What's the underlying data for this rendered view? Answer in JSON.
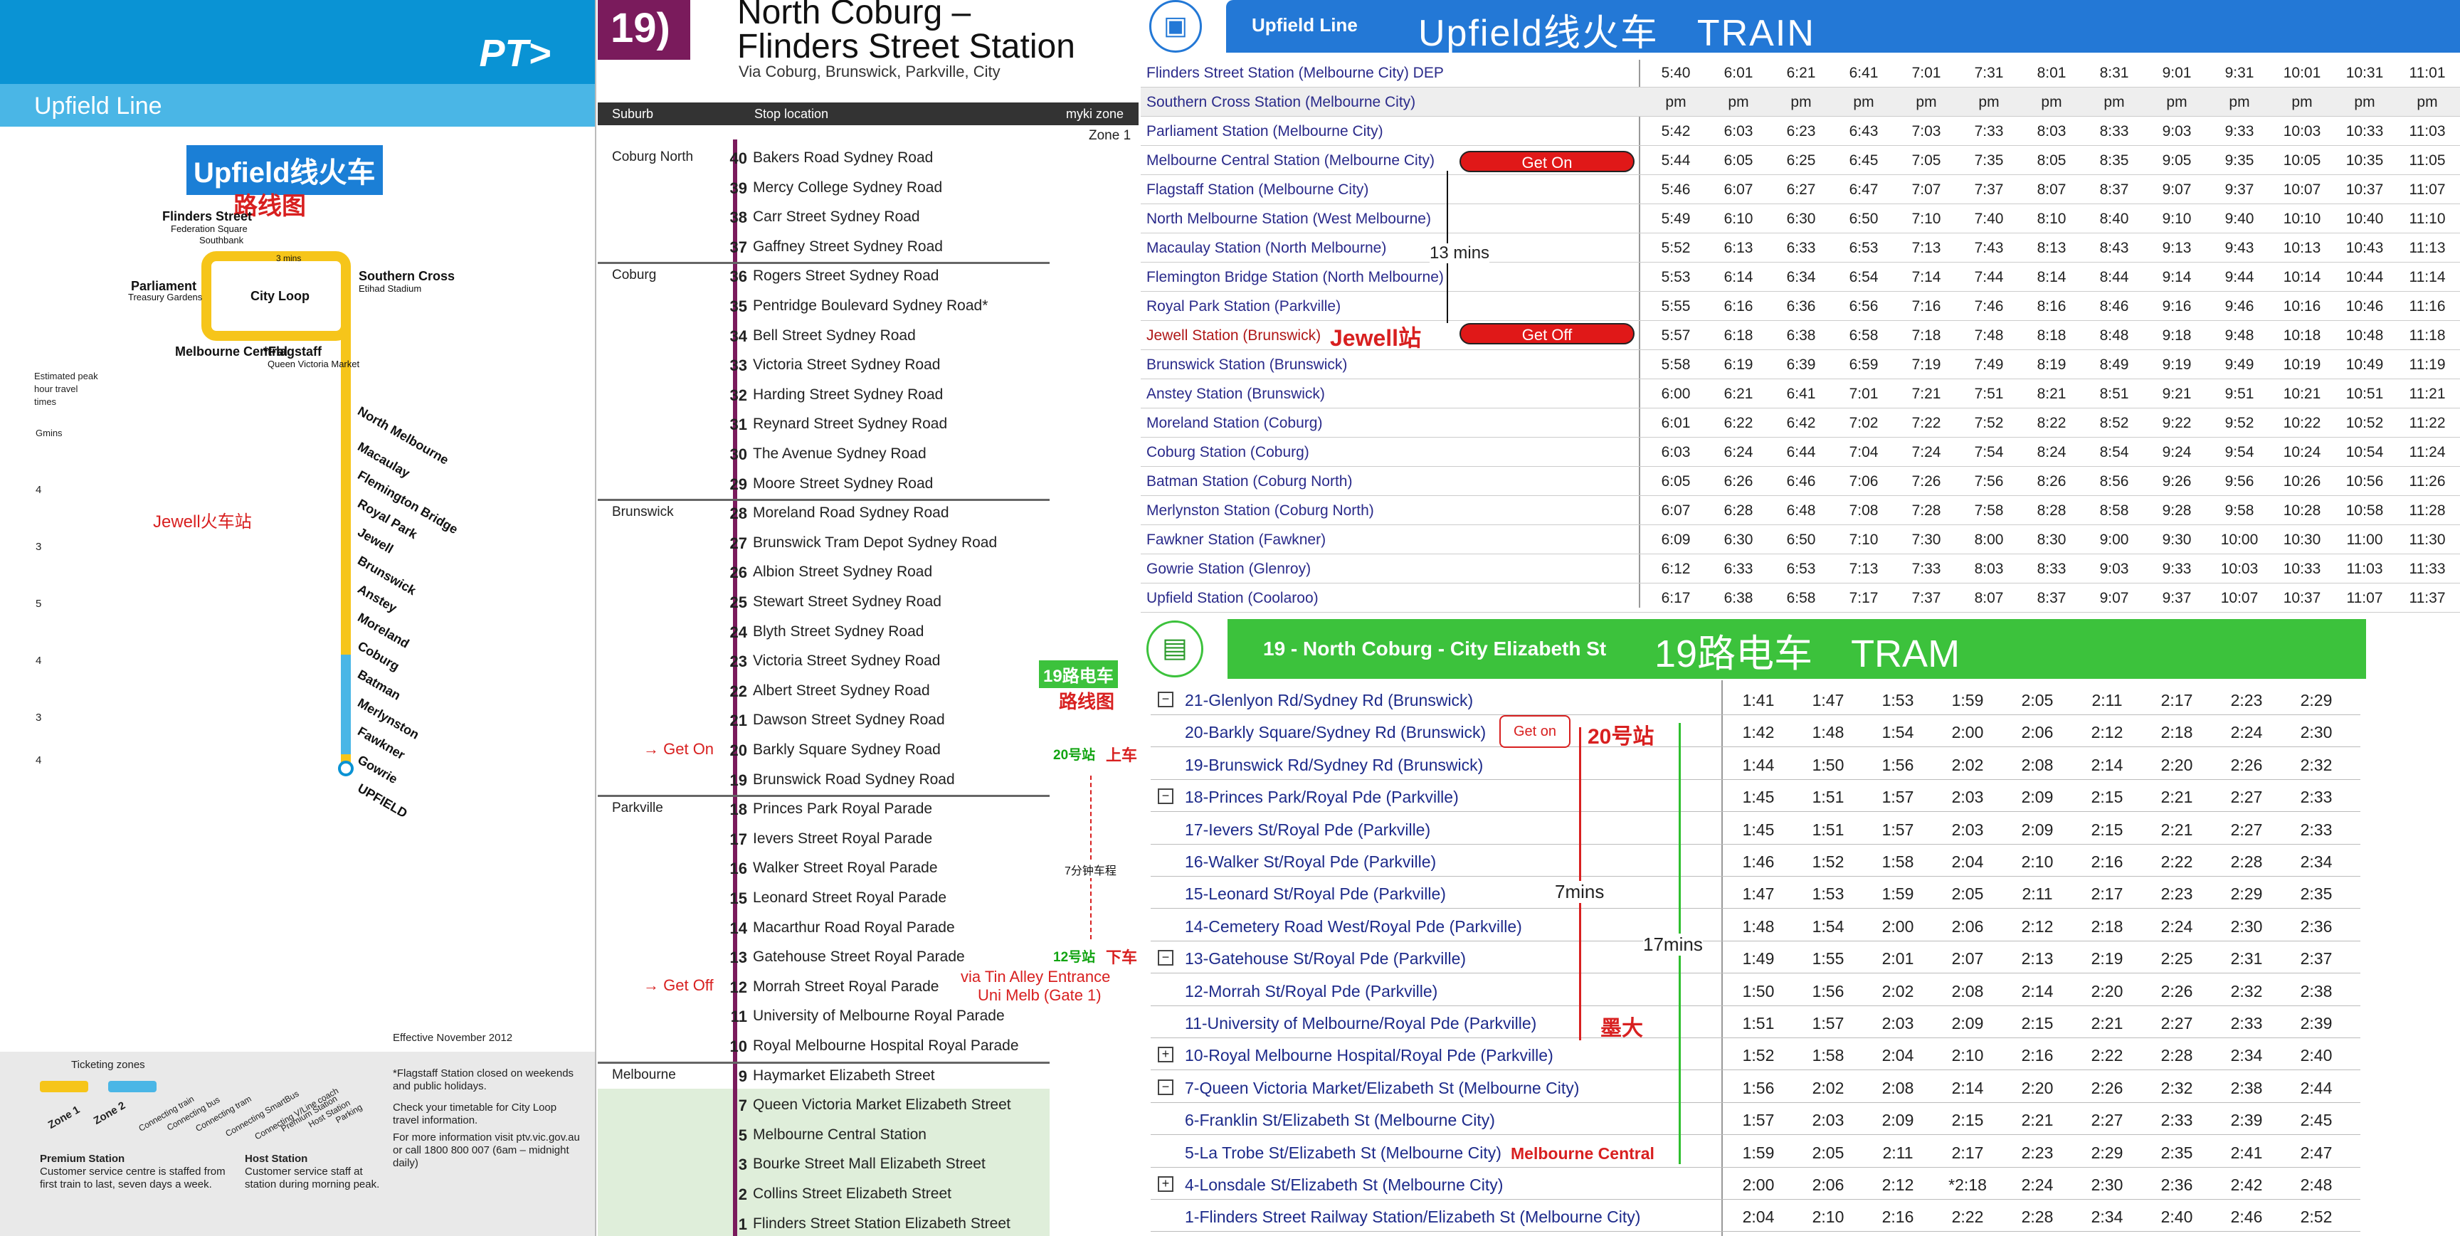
{
  "map": {
    "logo": "PT>",
    "line_name": "Upfield Line",
    "title_cn": "Upfield线火车",
    "subtitle_cn": "路线图",
    "stations": [
      "Flinders Street",
      "Federation Square",
      "Southbank",
      "Parliament",
      "Treasury Gardens",
      "City Loop",
      "Southern Cross",
      "Etihad Stadium",
      "Melbourne Central",
      "*Flagstaff",
      "Queen Victoria Market",
      "North Melbourne",
      "Macaulay",
      "Flemington Bridge",
      "Royal Park",
      "Jewell",
      "Brunswick",
      "Anstey",
      "Moreland",
      "Coburg",
      "Batman",
      "Merlynston",
      "Fawkner",
      "Gowrie",
      "UPFIELD"
    ],
    "loop_mins": "3 mins",
    "jewell_note": "Jewell火车站",
    "travel_label": "Estimated peak hour travel times",
    "mins_label": "Gmins",
    "travel_times": [
      "4",
      "3",
      "5",
      "4",
      "3",
      "4"
    ],
    "effective": "Effective November 2012",
    "ticketing_zones": "Ticketing zones",
    "zone1": "Zone 1",
    "zone2": "Zone 2",
    "legend_items": [
      "Connecting train",
      "Connecting bus",
      "Connecting tram",
      "Connecting SmartBus",
      "Connecting V/Line coach",
      "Premium Station",
      "Host Station",
      "Parking"
    ],
    "flagstaff_note": "*Flagstaff Station closed on weekends and public holidays.",
    "check_note": "Check your timetable for City Loop travel information.",
    "info_note": "For more information visit ptv.vic.gov.au or call 1800 800 007 (6am – midnight daily)",
    "premium_title": "Premium Station",
    "premium_text": "Customer service centre is staffed from first train to last, seven days a week.",
    "host_title": "Host Station",
    "host_text": "Customer service staff at station during morning peak."
  },
  "tram": {
    "route": "19",
    "title_line1": "North Coburg –",
    "title_line2": "Flinders Street Station",
    "via": "Via Coburg, Brunswick, Parkville, City",
    "col_suburb": "Suburb",
    "col_stop": "Stop location",
    "col_zone": "myki zone",
    "zone1": "Zone 1",
    "cn_title": "19路电车",
    "cn_sub": "路线图",
    "get_on": "Get On",
    "get_off": "Get Off",
    "stop20_cn": "20号站",
    "up_cn": "上车",
    "travel_cn": "7分钟车程",
    "stop12_cn": "12号站",
    "down_cn": "下车",
    "via_tin": "via Tin Alley Entrance",
    "gate": "Uni Melb (Gate 1)",
    "suburbs": [
      {
        "name": "Coburg North",
        "first": 40
      },
      {
        "name": "Coburg",
        "first": 36
      },
      {
        "name": "Brunswick",
        "first": 28
      },
      {
        "name": "Parkville",
        "first": 18
      },
      {
        "name": "Melbourne",
        "first": 9
      }
    ],
    "stops": [
      {
        "num": "40",
        "name": "Bakers Road Sydney Road"
      },
      {
        "num": "39",
        "name": "Mercy College Sydney Road"
      },
      {
        "num": "38",
        "name": "Carr Street Sydney Road"
      },
      {
        "num": "37",
        "name": "Gaffney Street Sydney Road"
      },
      {
        "num": "36",
        "name": "Rogers Street Sydney Road"
      },
      {
        "num": "35",
        "name": "Pentridge Boulevard Sydney Road*"
      },
      {
        "num": "34",
        "name": "Bell Street Sydney Road"
      },
      {
        "num": "33",
        "name": "Victoria Street Sydney Road"
      },
      {
        "num": "32",
        "name": "Harding Street Sydney Road"
      },
      {
        "num": "31",
        "name": "Reynard Street Sydney Road"
      },
      {
        "num": "30",
        "name": "The Avenue Sydney Road"
      },
      {
        "num": "29",
        "name": "Moore Street Sydney Road"
      },
      {
        "num": "28",
        "name": "Moreland Road Sydney Road"
      },
      {
        "num": "27",
        "name": "Brunswick Tram Depot Sydney Road"
      },
      {
        "num": "26",
        "name": "Albion Street Sydney Road"
      },
      {
        "num": "25",
        "name": "Stewart Street Sydney Road"
      },
      {
        "num": "24",
        "name": "Blyth Street Sydney Road"
      },
      {
        "num": "23",
        "name": "Victoria Street Sydney Road"
      },
      {
        "num": "22",
        "name": "Albert Street Sydney Road"
      },
      {
        "num": "21",
        "name": "Dawson Street Sydney Road"
      },
      {
        "num": "20",
        "name": "Barkly Square Sydney Road"
      },
      {
        "num": "19",
        "name": "Brunswick Road Sydney Road"
      },
      {
        "num": "18",
        "name": "Princes Park Royal Parade"
      },
      {
        "num": "17",
        "name": "Ievers Street Royal Parade"
      },
      {
        "num": "16",
        "name": "Walker Street Royal Parade"
      },
      {
        "num": "15",
        "name": "Leonard Street Royal Parade"
      },
      {
        "num": "14",
        "name": "Macarthur Road Royal Parade"
      },
      {
        "num": "13",
        "name": "Gatehouse Street Royal Parade"
      },
      {
        "num": "12",
        "name": "Morrah Street Royal Parade"
      },
      {
        "num": "11",
        "name": "University of Melbourne Royal Parade"
      },
      {
        "num": "10",
        "name": "Royal Melbourne Hospital Royal Parade"
      },
      {
        "num": "9",
        "name": "Haymarket Elizabeth Street"
      },
      {
        "num": "7",
        "name": "Queen Victoria Market Elizabeth Street"
      },
      {
        "num": "5",
        "name": "Melbourne Central Station"
      },
      {
        "num": "3",
        "name": "Bourke Street Mall Elizabeth Street"
      },
      {
        "num": "2",
        "name": "Collins Street Elizabeth Street"
      },
      {
        "num": "1",
        "name": "Flinders Street Station Elizabeth Street"
      }
    ]
  },
  "train": {
    "header_label": "Upfield Line",
    "header_cn": "Upfield线火车　TRAIN",
    "get_on": "Get On",
    "get_off": "Get Off",
    "jewell_cn": "Jewell站",
    "mins13": "13 mins",
    "rows": [
      {
        "station": "Flinders Street Station (Melbourne City)  DEP",
        "times": [
          "5:40",
          "6:01",
          "6:21",
          "6:41",
          "7:01",
          "7:31",
          "8:01",
          "8:31",
          "9:01",
          "9:31",
          "10:01",
          "10:31",
          "11:01"
        ]
      },
      {
        "station": "Southern Cross Station (Melbourne City)",
        "times": [
          "pm",
          "pm",
          "pm",
          "pm",
          "pm",
          "pm",
          "pm",
          "pm",
          "pm",
          "pm",
          "pm",
          "pm",
          "pm"
        ]
      },
      {
        "station": "Parliament Station (Melbourne City)",
        "times": [
          "5:42",
          "6:03",
          "6:23",
          "6:43",
          "7:03",
          "7:33",
          "8:03",
          "8:33",
          "9:03",
          "9:33",
          "10:03",
          "10:33",
          "11:03"
        ]
      },
      {
        "station": "Melbourne Central Station (Melbourne City)",
        "times": [
          "5:44",
          "6:05",
          "6:25",
          "6:45",
          "7:05",
          "7:35",
          "8:05",
          "8:35",
          "9:05",
          "9:35",
          "10:05",
          "10:35",
          "11:05"
        ]
      },
      {
        "station": "Flagstaff Station (Melbourne City)",
        "times": [
          "5:46",
          "6:07",
          "6:27",
          "6:47",
          "7:07",
          "7:37",
          "8:07",
          "8:37",
          "9:07",
          "9:37",
          "10:07",
          "10:37",
          "11:07"
        ]
      },
      {
        "station": "North Melbourne Station (West Melbourne)",
        "times": [
          "5:49",
          "6:10",
          "6:30",
          "6:50",
          "7:10",
          "7:40",
          "8:10",
          "8:40",
          "9:10",
          "9:40",
          "10:10",
          "10:40",
          "11:10"
        ]
      },
      {
        "station": "Macaulay Station (North Melbourne)",
        "times": [
          "5:52",
          "6:13",
          "6:33",
          "6:53",
          "7:13",
          "7:43",
          "8:13",
          "8:43",
          "9:13",
          "9:43",
          "10:13",
          "10:43",
          "11:13"
        ]
      },
      {
        "station": "Flemington Bridge Station (North Melbourne)",
        "times": [
          "5:53",
          "6:14",
          "6:34",
          "6:54",
          "7:14",
          "7:44",
          "8:14",
          "8:44",
          "9:14",
          "9:44",
          "10:14",
          "10:44",
          "11:14"
        ]
      },
      {
        "station": "Royal Park Station (Parkville)",
        "times": [
          "5:55",
          "6:16",
          "6:36",
          "6:56",
          "7:16",
          "7:46",
          "8:16",
          "8:46",
          "9:16",
          "9:46",
          "10:16",
          "10:46",
          "11:16"
        ]
      },
      {
        "station": "Jewell Station (Brunswick)",
        "times": [
          "5:57",
          "6:18",
          "6:38",
          "6:58",
          "7:18",
          "7:48",
          "8:18",
          "8:48",
          "9:18",
          "9:48",
          "10:18",
          "10:48",
          "11:18"
        ]
      },
      {
        "station": "Brunswick Station (Brunswick)",
        "times": [
          "5:58",
          "6:19",
          "6:39",
          "6:59",
          "7:19",
          "7:49",
          "8:19",
          "8:49",
          "9:19",
          "9:49",
          "10:19",
          "10:49",
          "11:19"
        ]
      },
      {
        "station": "Anstey Station (Brunswick)",
        "times": [
          "6:00",
          "6:21",
          "6:41",
          "7:01",
          "7:21",
          "7:51",
          "8:21",
          "8:51",
          "9:21",
          "9:51",
          "10:21",
          "10:51",
          "11:21"
        ]
      },
      {
        "station": "Moreland Station (Coburg)",
        "times": [
          "6:01",
          "6:22",
          "6:42",
          "7:02",
          "7:22",
          "7:52",
          "8:22",
          "8:52",
          "9:22",
          "9:52",
          "10:22",
          "10:52",
          "11:22"
        ]
      },
      {
        "station": "Coburg Station (Coburg)",
        "times": [
          "6:03",
          "6:24",
          "6:44",
          "7:04",
          "7:24",
          "7:54",
          "8:24",
          "8:54",
          "9:24",
          "9:54",
          "10:24",
          "10:54",
          "11:24"
        ]
      },
      {
        "station": "Batman Station (Coburg North)",
        "times": [
          "6:05",
          "6:26",
          "6:46",
          "7:06",
          "7:26",
          "7:56",
          "8:26",
          "8:56",
          "9:26",
          "9:56",
          "10:26",
          "10:56",
          "11:26"
        ]
      },
      {
        "station": "Merlynston Station (Coburg North)",
        "times": [
          "6:07",
          "6:28",
          "6:48",
          "7:08",
          "7:28",
          "7:58",
          "8:28",
          "8:58",
          "9:28",
          "9:58",
          "10:28",
          "10:58",
          "11:28"
        ]
      },
      {
        "station": "Fawkner Station (Fawkner)",
        "times": [
          "6:09",
          "6:30",
          "6:50",
          "7:10",
          "7:30",
          "8:00",
          "8:30",
          "9:00",
          "9:30",
          "10:00",
          "10:30",
          "11:00",
          "11:30"
        ]
      },
      {
        "station": "Gowrie Station (Glenroy)",
        "times": [
          "6:12",
          "6:33",
          "6:53",
          "7:13",
          "7:33",
          "8:03",
          "8:33",
          "9:03",
          "9:33",
          "10:03",
          "10:33",
          "11:03",
          "11:33"
        ]
      },
      {
        "station": "Upfield Station (Coolaroo)",
        "times": [
          "6:17",
          "6:38",
          "6:58",
          "7:17",
          "7:37",
          "8:07",
          "8:37",
          "9:07",
          "9:37",
          "10:07",
          "10:37",
          "11:07",
          "11:37"
        ]
      }
    ]
  },
  "tram_table": {
    "header_label": "19 - North Coburg - City Elizabeth St",
    "header_cn": "19路电车　TRAM",
    "get_on": "Get on",
    "stop20_cn": "20号站",
    "mins7": "7mins",
    "mins17": "17mins",
    "uni_cn": "墨大",
    "melb_central": "Melbourne Central",
    "rows": [
      {
        "box": "−",
        "station": "21-Glenlyon Rd/Sydney Rd (Brunswick)",
        "times": [
          "1:41",
          "1:47",
          "1:53",
          "1:59",
          "2:05",
          "2:11",
          "2:17",
          "2:23",
          "2:29"
        ]
      },
      {
        "box": "",
        "station": "20-Barkly Square/Sydney Rd (Brunswick)",
        "times": [
          "1:42",
          "1:48",
          "1:54",
          "2:00",
          "2:06",
          "2:12",
          "2:18",
          "2:24",
          "2:30"
        ]
      },
      {
        "box": "",
        "station": "19-Brunswick Rd/Sydney Rd (Brunswick)",
        "times": [
          "1:44",
          "1:50",
          "1:56",
          "2:02",
          "2:08",
          "2:14",
          "2:20",
          "2:26",
          "2:32"
        ]
      },
      {
        "box": "−",
        "station": "18-Princes Park/Royal Pde (Parkville)",
        "times": [
          "1:45",
          "1:51",
          "1:57",
          "2:03",
          "2:09",
          "2:15",
          "2:21",
          "2:27",
          "2:33"
        ]
      },
      {
        "box": "",
        "station": "17-Ievers St/Royal Pde (Parkville)",
        "times": [
          "1:45",
          "1:51",
          "1:57",
          "2:03",
          "2:09",
          "2:15",
          "2:21",
          "2:27",
          "2:33"
        ]
      },
      {
        "box": "",
        "station": "16-Walker St/Royal Pde (Parkville)",
        "times": [
          "1:46",
          "1:52",
          "1:58",
          "2:04",
          "2:10",
          "2:16",
          "2:22",
          "2:28",
          "2:34"
        ]
      },
      {
        "box": "",
        "station": "15-Leonard St/Royal Pde (Parkville)",
        "times": [
          "1:47",
          "1:53",
          "1:59",
          "2:05",
          "2:11",
          "2:17",
          "2:23",
          "2:29",
          "2:35"
        ]
      },
      {
        "box": "",
        "station": "14-Cemetery Road West/Royal Pde (Parkville)",
        "times": [
          "1:48",
          "1:54",
          "2:00",
          "2:06",
          "2:12",
          "2:18",
          "2:24",
          "2:30",
          "2:36"
        ]
      },
      {
        "box": "−",
        "station": "13-Gatehouse St/Royal Pde (Parkville)",
        "times": [
          "1:49",
          "1:55",
          "2:01",
          "2:07",
          "2:13",
          "2:19",
          "2:25",
          "2:31",
          "2:37"
        ]
      },
      {
        "box": "",
        "station": "12-Morrah St/Royal Pde (Parkville)",
        "times": [
          "1:50",
          "1:56",
          "2:02",
          "2:08",
          "2:14",
          "2:20",
          "2:26",
          "2:32",
          "2:38"
        ]
      },
      {
        "box": "",
        "station": "11-University of Melbourne/Royal Pde (Parkville)",
        "times": [
          "1:51",
          "1:57",
          "2:03",
          "2:09",
          "2:15",
          "2:21",
          "2:27",
          "2:33",
          "2:39"
        ]
      },
      {
        "box": "+",
        "station": "10-Royal Melbourne Hospital/Royal Pde (Parkville)",
        "times": [
          "1:52",
          "1:58",
          "2:04",
          "2:10",
          "2:16",
          "2:22",
          "2:28",
          "2:34",
          "2:40"
        ]
      },
      {
        "box": "−",
        "station": "7-Queen Victoria Market/Elizabeth St (Melbourne City)",
        "times": [
          "1:56",
          "2:02",
          "2:08",
          "2:14",
          "2:20",
          "2:26",
          "2:32",
          "2:38",
          "2:44"
        ]
      },
      {
        "box": "",
        "station": "6-Franklin St/Elizabeth St (Melbourne City)",
        "times": [
          "1:57",
          "2:03",
          "2:09",
          "2:15",
          "2:21",
          "2:27",
          "2:33",
          "2:39",
          "2:45"
        ]
      },
      {
        "box": "",
        "station": "5-La Trobe St/Elizabeth St (Melbourne City)",
        "times": [
          "1:59",
          "2:05",
          "2:11",
          "2:17",
          "2:23",
          "2:29",
          "2:35",
          "2:41",
          "2:47"
        ]
      },
      {
        "box": "+",
        "station": "4-Lonsdale St/Elizabeth St (Melbourne City)",
        "times": [
          "2:00",
          "2:06",
          "2:12",
          "*2:18",
          "2:24",
          "2:30",
          "2:36",
          "2:42",
          "2:48"
        ]
      },
      {
        "box": "",
        "station": "1-Flinders Street Railway Station/Elizabeth St (Melbourne City)",
        "times": [
          "2:04",
          "2:10",
          "2:16",
          "2:22",
          "2:28",
          "2:34",
          "2:40",
          "2:46",
          "2:52"
        ]
      }
    ]
  },
  "colors": {
    "ptv_blue": "#0a93d4",
    "upfield_yellow": "#f6c51a",
    "route19_purple": "#7a1b5c",
    "train_header": "#2378d6",
    "tram_header": "#3cc23c",
    "annotation_red": "#d82020"
  }
}
